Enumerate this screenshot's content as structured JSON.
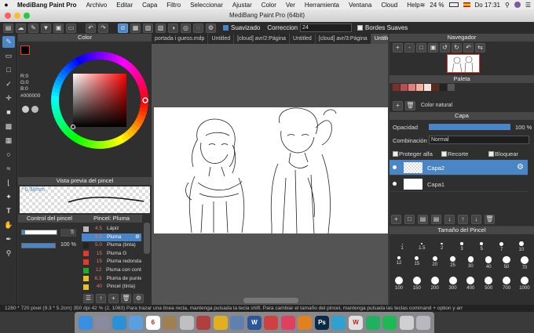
{
  "menubar": {
    "apple": "",
    "app": "MediBang Paint Pro",
    "items": [
      "Archivo",
      "Editar",
      "Capa",
      "Filtro",
      "Seleccionar",
      "Ajustar",
      "Color",
      "Ver",
      "Herramienta",
      "Ventana",
      "Cloud",
      "Help"
    ],
    "battery": "24 %",
    "clock": "Do 17:31"
  },
  "window": {
    "title": "MediBang Paint Pro (64bit)"
  },
  "toolbar": {
    "smoothing_label": "Suavizado",
    "correction_label": "Correccion",
    "correction_value": "24",
    "soft_edges_label": "Bordes Suaves"
  },
  "tabs": [
    "portada i guess.mdp",
    "Untitled",
    "[cloud] avr/2:Página",
    "Untitled",
    "[cloud] avr/3:Página",
    "Untitled"
  ],
  "color_panel": {
    "title": "Color",
    "r": "R:0",
    "g": "G:0",
    "b": "B:0",
    "hex": "#000000"
  },
  "brush_preview": {
    "title": "Vista previa del pincel",
    "size": "0.36mm"
  },
  "brush_control": {
    "title": "Control del pincel",
    "size": "5",
    "opacity": "100 %",
    "opacity_fill": 1.0
  },
  "brushes": {
    "title": "Pincel: Pluma",
    "items": [
      {
        "num": "4.5",
        "name": "Lápiz",
        "color": "#bbbbbb",
        "selected": false
      },
      {
        "num": "5.0",
        "name": "Pluma",
        "color": "#4a86c6",
        "selected": true
      },
      {
        "num": "5.0",
        "name": "Pluma (tinta)",
        "color": "#222222",
        "selected": false
      },
      {
        "num": "15",
        "name": "Pluma G",
        "color": "#e23a2a",
        "selected": false
      },
      {
        "num": "15",
        "name": "Pluma redonda",
        "color": "#e23a2a",
        "selected": false
      },
      {
        "num": "12",
        "name": "Pluma con contr",
        "color": "#22aa22",
        "selected": false
      },
      {
        "num": "6.3",
        "name": "Pluma de punte",
        "color": "#e8c02a",
        "selected": false
      },
      {
        "num": "40",
        "name": "Pincel (tinta)",
        "color": "#e8c02a",
        "selected": false
      }
    ]
  },
  "navigator": {
    "title": "Navegador"
  },
  "palette": {
    "title": "Paleta",
    "name": "Color natural",
    "swatches": [
      "#7a3030",
      "#b55050",
      "#e08080",
      "#f4b0a0",
      "#fbe0d8",
      "#5a2a1a",
      "#222222",
      "#555555"
    ]
  },
  "layers": {
    "title": "Capa",
    "opacity_label": "Opacidad",
    "opacity": "100 %",
    "opacity_fill": 1.0,
    "blend_label": "Combinación",
    "blend": "Normal",
    "protect_alpha": "Proteger alfa",
    "clip": "Recorte",
    "lock": "Bloquear",
    "items": [
      {
        "name": "Capa2",
        "selected": true
      },
      {
        "name": "Capa1",
        "selected": false
      }
    ]
  },
  "brush_size": {
    "title": "Tamaño del Pincel",
    "row1": [
      "1",
      "1.5",
      "2",
      "3",
      "5",
      "7",
      "10"
    ],
    "row2": [
      "12",
      "15",
      "20",
      "25",
      "30",
      "40",
      "50",
      "70"
    ],
    "row3": [
      "100",
      "150",
      "200",
      "300",
      "400",
      "500",
      "700",
      "1000"
    ]
  },
  "status": {
    "text": "1280 * 720 pixel   (9.3 * 5.2cm)   350 dpi   42 %   (2, 1063)   Para trazar una línea recta, mantenga pulsada la tecla shift. Para cambiar el tamaño del pincel, mantenga pulsada las teclas command + option y arr"
  },
  "dock": {
    "apps": [
      {
        "name": "Finder",
        "label": "",
        "color": "#3b8de0"
      },
      {
        "name": "Launchpad",
        "label": "",
        "color": "#8a8aa0"
      },
      {
        "name": "Safari",
        "label": "",
        "color": "#2a90d8"
      },
      {
        "name": "Mail",
        "label": "",
        "color": "#5aa0e0"
      },
      {
        "name": "Calendar",
        "label": "6",
        "color": "#ffffff"
      },
      {
        "name": "Notes",
        "label": "",
        "color": "#a08050"
      },
      {
        "name": "Photos",
        "label": "",
        "color": "#c0c0c0"
      },
      {
        "name": "Contacts",
        "label": "",
        "color": "#b04040"
      },
      {
        "name": "Chrome",
        "label": "",
        "color": "#e0b020"
      },
      {
        "name": "Preview",
        "label": "",
        "color": "#6080b0"
      },
      {
        "name": "Word",
        "label": "W",
        "color": "#2b579a"
      },
      {
        "name": "Popcorn",
        "label": "",
        "color": "#d04040"
      },
      {
        "name": "Music",
        "label": "",
        "color": "#e04060"
      },
      {
        "name": "Books",
        "label": "",
        "color": "#e08020"
      },
      {
        "name": "Photoshop",
        "label": "Ps",
        "color": "#0a2a4a"
      },
      {
        "name": "Stickies",
        "label": "",
        "color": "#30a0d0"
      },
      {
        "name": "Wattpad",
        "label": "W",
        "color": "#e0e0e0"
      },
      {
        "name": "MediBang",
        "label": "",
        "color": "#20b060"
      },
      {
        "name": "Spotify",
        "label": "",
        "color": "#1db954"
      },
      {
        "name": "Chrome2",
        "label": "",
        "color": "#d0d0d0"
      },
      {
        "name": "Trash",
        "label": "",
        "color": "#b8b8c0"
      }
    ]
  }
}
